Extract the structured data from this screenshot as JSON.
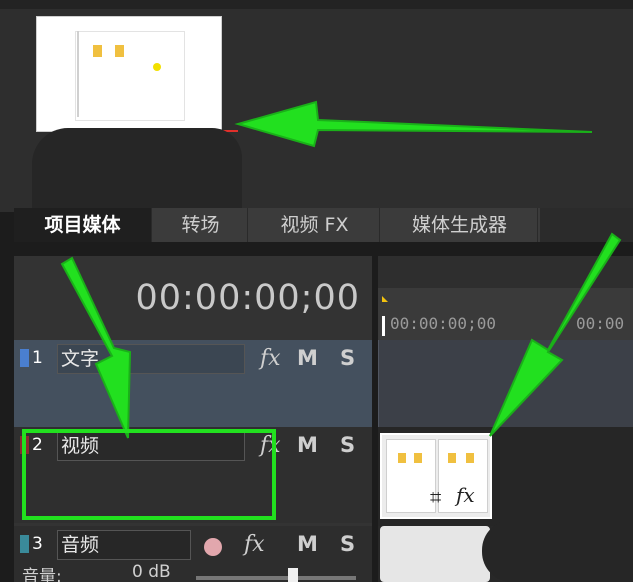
{
  "tabs": [
    {
      "label": "项目媒体",
      "active": true
    },
    {
      "label": "转场",
      "active": false
    },
    {
      "label": "视频 FX",
      "active": false
    },
    {
      "label": "媒体生成器",
      "active": false
    }
  ],
  "timeline": {
    "timecode": "00:00:00;00",
    "ruler_labels": [
      "00:00:00;00",
      "00:00"
    ]
  },
  "tracks": [
    {
      "number": "1",
      "name": "文字",
      "fx": "fx",
      "mute": "M",
      "solo": "S",
      "badge_color": "#4a7fd0"
    },
    {
      "number": "2",
      "name": "视频",
      "fx": "fx",
      "mute": "M",
      "solo": "S",
      "badge_color": "#8a2a32"
    },
    {
      "number": "3",
      "name": "音频",
      "fx": "fx",
      "mute": "M",
      "solo": "S",
      "badge_color": "#3a8a9a"
    }
  ],
  "audio_volume": {
    "label": "音量:",
    "value": "0 dB"
  },
  "clip": {
    "fx_label": "fx"
  },
  "colors": {
    "annotation_green": "#22e01f",
    "text_track_bg": "#44505e",
    "playhead_marker": "#f2c20f"
  }
}
